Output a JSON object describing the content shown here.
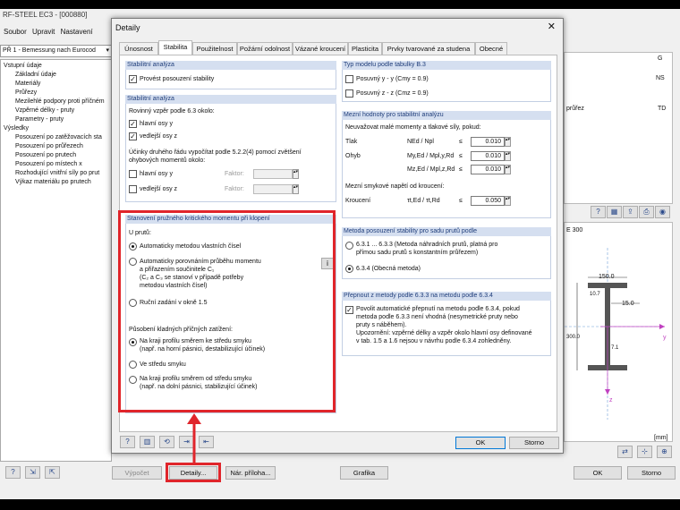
{
  "app": {
    "title": "RF-STEEL EC3 - [000880]",
    "menu": [
      "Soubor",
      "Upravit",
      "Nastavení"
    ],
    "case_select": "PŘ 1 - Bemessung nach Eurocod",
    "tree": [
      "Vstupní údaje",
      "Základní údaje",
      "Materiály",
      "Průřezy",
      "Mezilehlé podpory proti příčném",
      "Vzpěrné délky - pruty",
      "Parametry - pruty",
      "Výsledky",
      "Posouzení po zatěžovacích sta",
      "Posouzení po průřezech",
      "Posouzení po prutech",
      "Posouzení po místech x",
      "Rozhodující vnitřní síly po prut",
      "Výkaz materiálu po prutech"
    ],
    "bottom": {
      "vypocet": "Výpočet",
      "detaily": "Detaily...",
      "nar_priloha": "Nár. příloha...",
      "grafika": "Grafika",
      "ok": "OK",
      "storno": "Storno"
    },
    "right_pane": {
      "col_g": "G",
      "col_ns": "NS",
      "col_prurez": "průřez",
      "col_td": "TD",
      "section_name": "E 300",
      "dim_150": "150.0",
      "dim_15": "15.0",
      "dim_107": "10.7",
      "dim_300": "300.0",
      "dim_71": "7.1",
      "axis_y": "y",
      "axis_z": "z",
      "unit": "[mm]"
    }
  },
  "dialog": {
    "title": "Detaily",
    "close": "✕",
    "tabs": [
      "Únosnost",
      "Stabilita",
      "Použitelnost",
      "Požární odolnost",
      "Vázané kroucení",
      "Plasticita",
      "Prvky tvarované za studena",
      "Obecné"
    ],
    "active_tab": "Stabilita",
    "stab_analyza": {
      "header": "Stabilitní analýza",
      "provest": "Provést posouzení stability"
    },
    "stab_analyza2": {
      "header": "Stabilitní analýza",
      "rovinny": "Rovinný vzpěr podle 6.3 okolo:",
      "hlavni_osy": "hlavní osy y",
      "vedlejsi_osy": "vedlejší osy z",
      "ucinky_1": "Účinky druhého řádu vypočítat podle 5.2.2(4) pomocí zvětšení",
      "ucinky_2": "ohybových momentů okolo:",
      "hlavni_osy2": "hlavní osy y",
      "vedlejsi_osy2": "vedlejší osy z",
      "faktor": "Faktor:"
    },
    "kriticky": {
      "header": "Stanovení pružného kritického momentu při klopení",
      "u_prutu": "U prutů:",
      "opt1": "Automaticky metodou vlastních čísel",
      "opt2_1": "Automaticky porovnáním průběhu momentu",
      "opt2_2": "a přiřazením součinitele C₁",
      "opt2_3": "(C₂ a C₃ se stanoví v případě potřeby",
      "opt2_4": "metodou vlastních čísel)",
      "opt3": "Ruční zadání v okně 1.5",
      "pusobeni": "Působení kladných příčných zatížení:",
      "l1_1": "Na kraji profilu směrem ke středu smyku",
      "l1_2": "(např. na horní pásnici, destabilizující účinek)",
      "l2": "Ve středu smyku",
      "l3_1": "Na kraji profilu směrem od středu smyku",
      "l3_2": "(např. na dolní pásnici, stabilizující účinek)",
      "info": "i"
    },
    "typ_modelu": {
      "header": "Typ modelu podle tabulky B.3",
      "yy": "Posuvný y - y (Cmy = 0.9)",
      "zz": "Posuvný z - z (Cmz = 0.9)"
    },
    "mezni": {
      "header": "Mezní hodnoty pro stabilitní analýzu",
      "neuvazovat": "Neuvažovat malé momenty a tlakové síly, pokud:",
      "tlak": "Tlak",
      "tlak_ratio": "NEd / Npl",
      "ohyb": "Ohyb",
      "my_ratio": "My,Ed / Mpl,y,Rd",
      "mz_ratio": "Mz,Ed / Mpl,z,Rd",
      "le": "≤",
      "v1": "0.010",
      "v2": "0.010",
      "v3": "0.010",
      "smykove": "Mezní smykové napětí od kroucení:",
      "krouceni": "Kroucení",
      "tau_ratio": "τt,Ed / τt,Rd",
      "v4": "0.050"
    },
    "metoda": {
      "header": "Metoda posouzení stability pro sadu prutů podle",
      "m1_1": "6.3.1 ... 6.3.3 (Metoda náhradních prutů, platná pro",
      "m1_2": "přímou sadu prutů s konstantním průřezem)",
      "m2": "6.3.4 (Obecná metoda)"
    },
    "prepnout": {
      "header": "Přepnout z metody podle 6.3.3 na metodu podle 6.3.4",
      "p1": "Povolit automatické přepnutí na metodu podle 6.3.4, pokud",
      "p2": "metoda podle 6.3.3 není vhodná (nesymetrické pruty nebo",
      "p3": "pruty s náběhem).",
      "p4": "Upozornění: vzpěrné délky a vzpěr okolo hlavní osy definované",
      "p5": "v tab. 1.5 a 1.6 nejsou v návrhu podle 6.3.4 zohledněny."
    },
    "ok": "OK",
    "storno": "Storno"
  }
}
